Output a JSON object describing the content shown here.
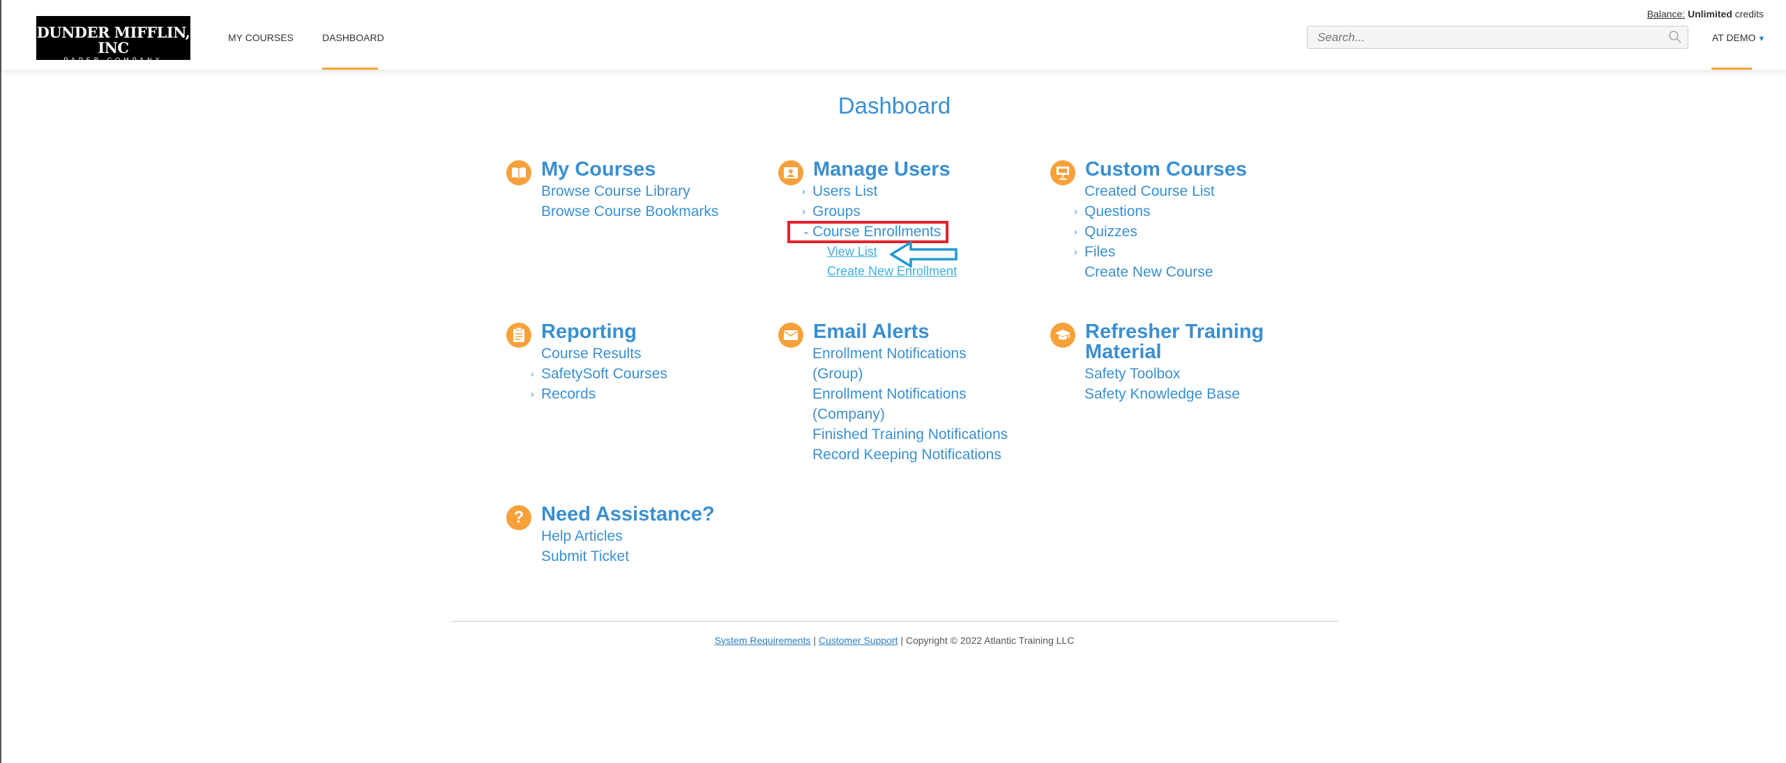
{
  "header": {
    "logo_name": "DUNDER MIFFLIN, INC",
    "logo_sub": "PAPER COMPANY",
    "nav": [
      "MY COURSES",
      "DASHBOARD"
    ],
    "balance_label": "Balance:",
    "balance_value": "Unlimited",
    "balance_unit": "credits",
    "search_placeholder": "Search...",
    "user_menu": "AT DEMO",
    "accent_color": "#f7a13a"
  },
  "page_title": "Dashboard",
  "sections": {
    "my_courses": {
      "title": "My Courses",
      "icon": "book-icon",
      "links": [
        "Browse Course Library",
        "Browse Course Bookmarks"
      ]
    },
    "manage_users": {
      "title": "Manage Users",
      "icon": "user-id-icon",
      "links": [
        "Users List",
        "Groups",
        "Course Enrollments"
      ],
      "enrollment_sub": [
        "View List",
        "Create New Enrollment"
      ]
    },
    "custom_courses": {
      "title": "Custom Courses",
      "icon": "presentation-icon",
      "links": [
        "Created Course List",
        "Questions",
        "Quizzes",
        "Files",
        "Create New Course"
      ]
    },
    "reporting": {
      "title": "Reporting",
      "icon": "clipboard-icon",
      "links": [
        "Course Results",
        "SafetySoft Courses",
        "Records"
      ]
    },
    "email_alerts": {
      "title": "Email Alerts",
      "icon": "envelope-icon",
      "links": [
        "Enrollment Notifications",
        "(Group)",
        "Enrollment Notifications",
        "(Company)",
        "Finished Training Notifications",
        "Record Keeping Notifications"
      ]
    },
    "refresher": {
      "title_line1": "Refresher Training",
      "title_line2": "Material",
      "icon": "graduation-cap-icon",
      "links": [
        "Safety Toolbox",
        "Safety Knowledge Base"
      ]
    },
    "assistance": {
      "title": "Need Assistance?",
      "icon": "question-icon",
      "links": [
        "Help Articles",
        "Submit Ticket"
      ]
    }
  },
  "footer": {
    "system_requirements": "System Requirements",
    "separator": "|",
    "customer_support": "Customer Support",
    "copyright": "Copyright © 2022 Atlantic Training LLC"
  }
}
